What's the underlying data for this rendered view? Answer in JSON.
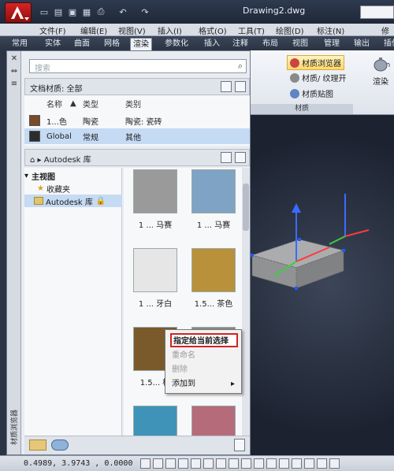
{
  "title_bar": {
    "document_title": "Drawing2.dwg",
    "quick_access_icons": [
      "new-icon",
      "open-icon",
      "save-icon",
      "save-as-icon",
      "print-icon",
      "undo-icon",
      "redo-icon"
    ]
  },
  "menu_bar": {
    "items": [
      "文件(F)",
      "编辑(E)",
      "视图(V)",
      "插入(I)",
      "格式(O)",
      "工具(T)",
      "绘图(D)",
      "标注(N)",
      "修"
    ]
  },
  "ribbon_tabs": {
    "tabs": [
      "常用",
      "实体",
      "曲面",
      "网格",
      "渲染",
      "参数化",
      "插入",
      "注释",
      "布局",
      "视图",
      "管理",
      "输出",
      "插件"
    ],
    "active": "渲染"
  },
  "ribbon_panel": {
    "material_browser": "材质浏览器",
    "material_texture": "材质/ 纹理开",
    "material_mapping": "材质贴图",
    "panel_title": "材质",
    "render": "渲染"
  },
  "palette": {
    "vertical_title": "材质浏览器",
    "search_placeholder": "搜索",
    "doc_materials": "文档材质: 全部",
    "table_headers": {
      "name": "名称",
      "type": "类型",
      "category": "类别"
    },
    "rows": [
      {
        "name": "1...色",
        "type": "陶瓷",
        "category": "陶瓷: 瓷砖",
        "swatch": "#7a4a2a"
      },
      {
        "name": "Global",
        "type": "常规",
        "category": "其他",
        "swatch": "#2c2c2c"
      }
    ],
    "library_crumb": "Autodesk 库",
    "tree": {
      "root": "主视图",
      "favorites": "收藏夹",
      "library": "Autodesk 库"
    },
    "thumbnails": [
      {
        "label": "1 ... 马赛",
        "color": "#9a9a9a"
      },
      {
        "label": "1 ... 马赛",
        "color": "#7fa3c4"
      },
      {
        "label": "1 ... 牙白",
        "color": "#e6e6e6"
      },
      {
        "label": "1.5... 茶色",
        "color": "#b8913a"
      },
      {
        "label": "1.5... 棕",
        "color": "#7a5a2a"
      },
      {
        "label": "",
        "color": "#888888"
      },
      {
        "label": "",
        "color": "#3f93b8"
      },
      {
        "label": "",
        "color": "#b56b7a"
      }
    ]
  },
  "context_menu": {
    "items": [
      "指定给当前选择",
      "重命名",
      "删除",
      "添加到"
    ],
    "highlighted": "指定给当前选择",
    "disabled": [
      "重命名",
      "删除"
    ]
  },
  "status_bar": {
    "coordinates": "0.4989,  3.9743  ,  0.0000"
  }
}
